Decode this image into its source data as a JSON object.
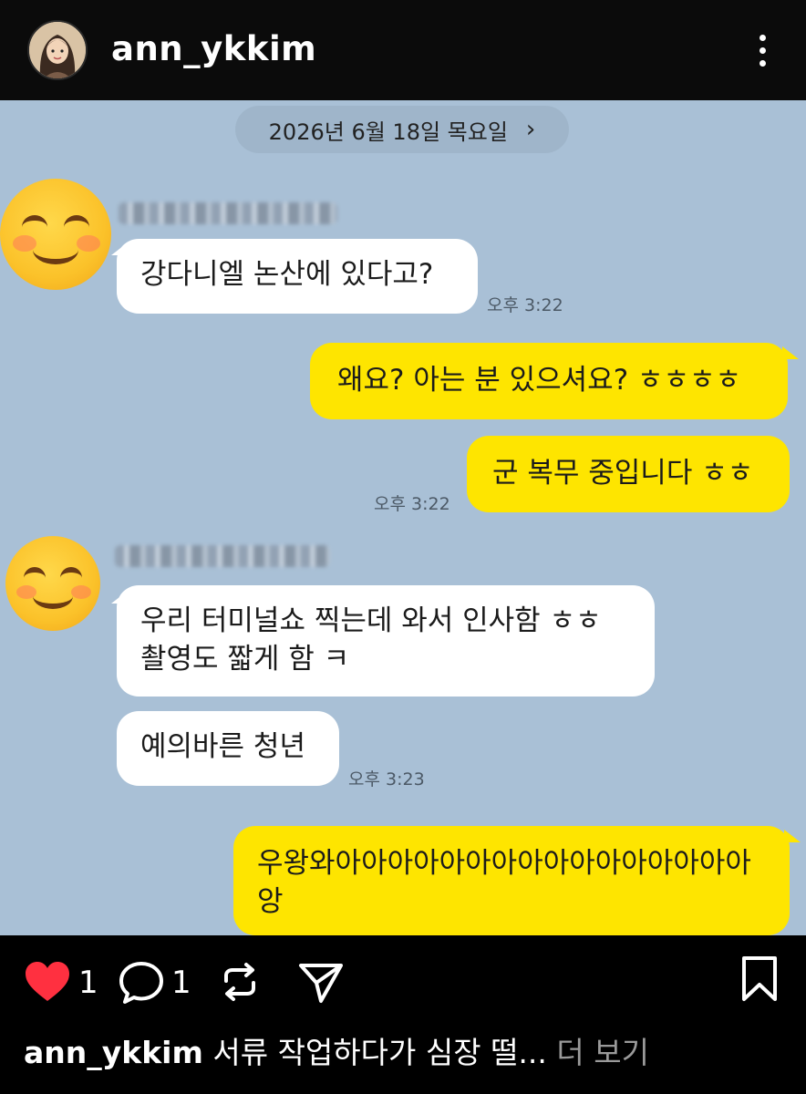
{
  "header": {
    "username": "ann_ykkim",
    "more_icon": "more-vertical-icon"
  },
  "chat": {
    "date_label": "2026년 6월 18일 목요일",
    "date_chevron": "›",
    "messages": [
      {
        "side": "in",
        "text": "강다니엘 논산에 있다고?",
        "time": "오후 3:22"
      },
      {
        "side": "out",
        "text": "왜요? 아는 분 있으셔요? ㅎㅎㅎㅎ"
      },
      {
        "side": "out",
        "text": "군 복무 중입니다 ㅎㅎ",
        "time": "오후 3:22"
      },
      {
        "side": "in",
        "line1": "우리 터미널쇼 찍는데 와서 인사함 ㅎㅎ",
        "line2": "촬영도 짧게 함 ㅋ"
      },
      {
        "side": "in",
        "text": "예의바른 청년",
        "time": "오후 3:23"
      },
      {
        "side": "out",
        "line1": "우왕와아아아아아아아아아아아아아아아아",
        "line2": "앙"
      }
    ]
  },
  "actions": {
    "like_count": "1",
    "comment_count": "1",
    "colors": {
      "like": "#ff3040",
      "bubble_out": "#fee500",
      "chat_bg": "#a9c0d6"
    }
  },
  "caption": {
    "username": "ann_ykkim",
    "text": "서류 작업하다가 심장 떨...",
    "more": "더 보기"
  }
}
